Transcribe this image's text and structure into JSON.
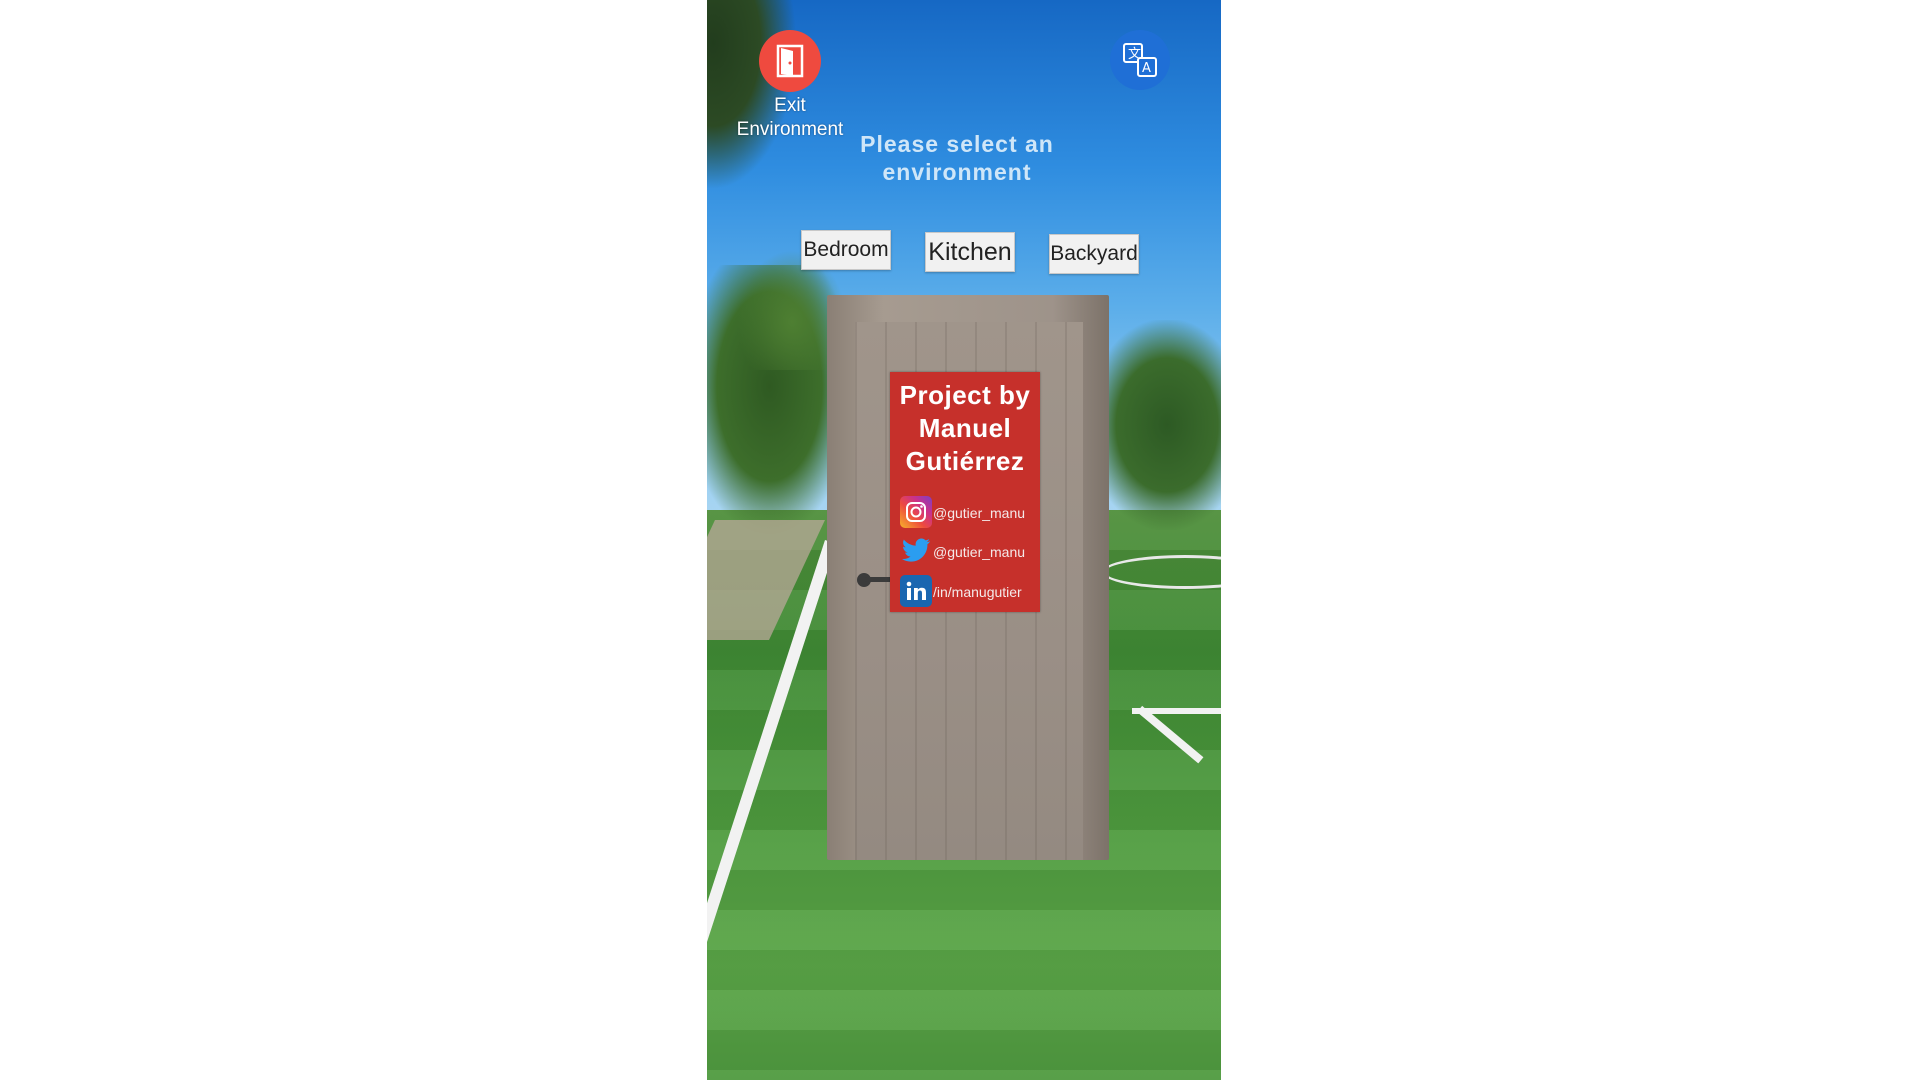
{
  "app": {
    "exit_label": "Exit\nEnvironment",
    "exit_icon": "door-exit-icon",
    "translate_icon": "translate-icon",
    "prompt": "Please select an environment",
    "environments": [
      "Bedroom",
      "Kitchen",
      "Backyard"
    ]
  },
  "sign": {
    "title": "Project by Manuel Gutiérrez",
    "socials": [
      {
        "icon": "instagram-icon",
        "handle": "@gutier_manu"
      },
      {
        "icon": "twitter-icon",
        "handle": "@gutier_manu"
      },
      {
        "icon": "linkedin-icon",
        "handle": "/in/manugutier"
      }
    ]
  },
  "colors": {
    "exit_button": "#ef4a3f",
    "translate_button": "#1f6fd6",
    "sign_background": "#c6302b"
  }
}
